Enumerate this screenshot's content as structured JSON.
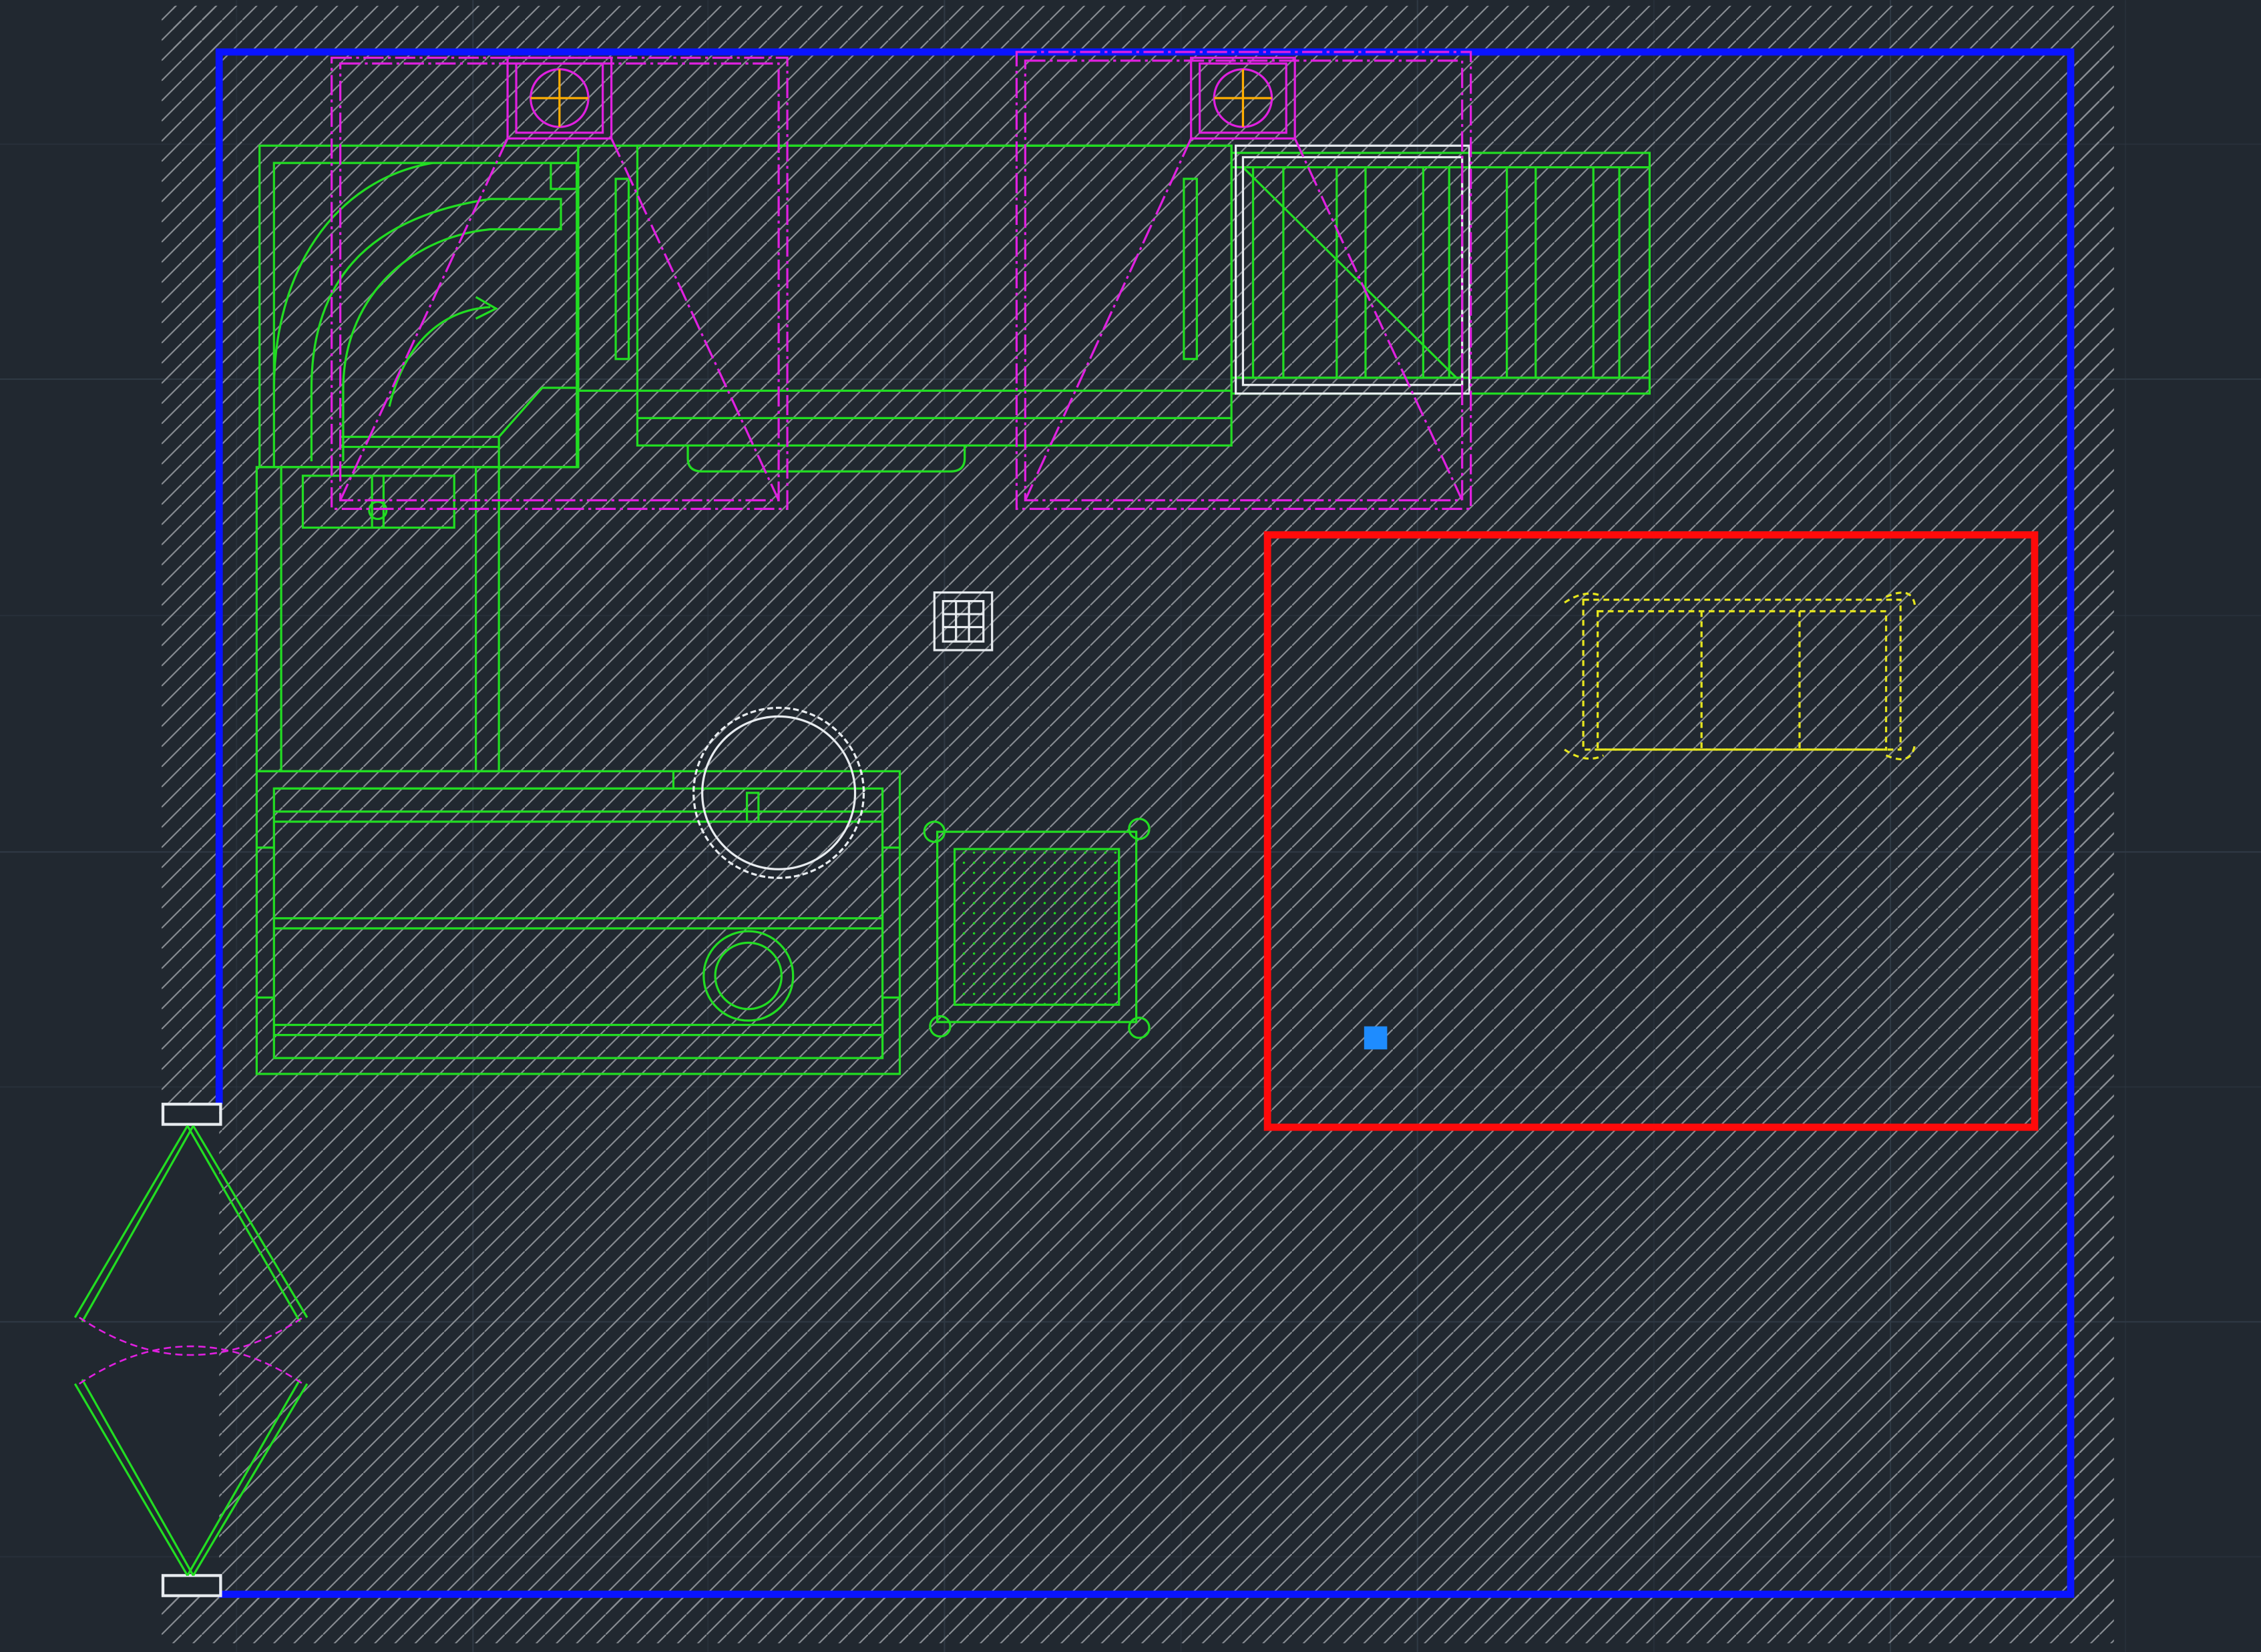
{
  "colors": {
    "background": "#212830",
    "grid": "#2f3944",
    "hatch": "#8a8f95",
    "wall": "#0a14ff",
    "equipment": "#22dd22",
    "overhead": "#e020e0",
    "selection": "#ff0a0a",
    "dashed": "#e6e61e",
    "white": "#e8ecf0",
    "crosshair": "#ffae00",
    "grip": "#1e8cff"
  },
  "icons": {
    "table-marker": "table-grid-icon",
    "selection-grip": "grip-square-icon"
  },
  "layers": [
    "grid",
    "hatched-walls",
    "room-boundary",
    "kitchen-equipment",
    "exhaust-hoods",
    "selection-window"
  ]
}
